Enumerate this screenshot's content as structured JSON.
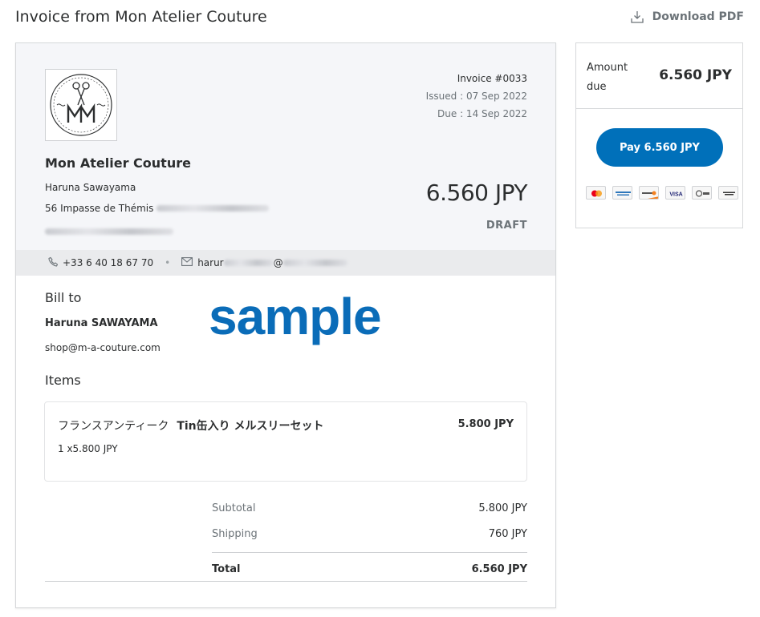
{
  "page": {
    "title": "Invoice from Mon Atelier Couture",
    "download_label": "Download PDF"
  },
  "invoice": {
    "number": "Invoice #0033",
    "issued": "Issued : 07 Sep 2022",
    "due": "Due : 14 Sep 2022",
    "amount": "6.560 JPY",
    "status": "DRAFT"
  },
  "merchant": {
    "name": "Mon Atelier Couture",
    "person": "Haruna Sawayama",
    "address": "56 Impasse de Thémis",
    "phone": "+33 6 40 18 67 70",
    "email_prefix": "harur",
    "email_at": "@"
  },
  "bill_to": {
    "label": "Bill to",
    "name": "Haruna SAWAYAMA",
    "email": "shop@m-a-couture.com"
  },
  "watermark": "sample",
  "items": {
    "label": "Items",
    "list": [
      {
        "name": "フランスアンティーク",
        "name_bold": "Tin缶入り メルスリーセット",
        "price": "5.800 JPY",
        "qty": "1 x5.800 JPY"
      }
    ]
  },
  "totals": {
    "subtotal_label": "Subtotal",
    "subtotal": "5.800 JPY",
    "shipping_label": "Shipping",
    "shipping": "760 JPY",
    "total_label": "Total",
    "total": "6.560 JPY"
  },
  "sidebar": {
    "amount_due_label": "Amount due",
    "amount_due": "6.560 JPY",
    "pay_button": "Pay 6.560 JPY",
    "card_icons": [
      "mastercard-icon",
      "amex-icon",
      "discover-icon",
      "visa-icon",
      "jcb-icon",
      "generic-card-icon"
    ]
  },
  "colors": {
    "pay_button": "#0070ba",
    "watermark": "#0a6cb8",
    "header_bg": "#f5f6f9",
    "contact_bar_bg": "#eaebed"
  }
}
